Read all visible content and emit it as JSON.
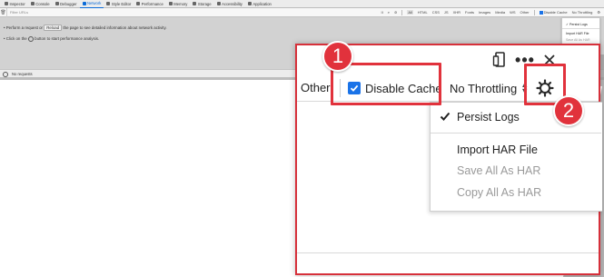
{
  "background": {
    "tabs": [
      {
        "label": "Inspector"
      },
      {
        "label": "Console"
      },
      {
        "label": "Debugger"
      },
      {
        "label": "Network",
        "active": true
      },
      {
        "label": "Style Editor"
      },
      {
        "label": "Performance"
      },
      {
        "label": "Memory"
      },
      {
        "label": "Storage"
      },
      {
        "label": "Accessibility"
      },
      {
        "label": "Application"
      }
    ],
    "filter_placeholder": "Filter URLs",
    "type_filters": [
      "All",
      "HTML",
      "CSS",
      "JS",
      "XHR",
      "Fonts",
      "Images",
      "Media",
      "WS",
      "Other"
    ],
    "disable_cache_label": "Disable Cache",
    "throttling_label": "No Throttling",
    "instruction_1_pre": "• Perform a request or",
    "instruction_1_button": "Reload",
    "instruction_1_post": "the page to see detailed information about network activity.",
    "instruction_2_pre": "• Click on the",
    "instruction_2_post": "button to start performance analysis.",
    "status": "No requests",
    "menu": {
      "persist": "Persist Logs",
      "import": "Import HAR File",
      "save": "Save All As HAR",
      "copy": "Copy All As HAR"
    }
  },
  "zoom": {
    "other_label": "Other",
    "disable_cache_label": "Disable Cache",
    "disable_cache_checked": true,
    "throttling_label": "No Throttling",
    "menu": {
      "persist_logs": "Persist Logs",
      "persist_logs_checked": true,
      "import_har": "Import HAR File",
      "save_all_har": "Save All As HAR",
      "copy_all_har": "Copy All As HAR"
    }
  },
  "annotations": {
    "badge_1": "1",
    "badge_2": "2"
  },
  "colors": {
    "accent_red": "#e1323c",
    "checkbox_blue": "#1a73e8",
    "active_tab_blue": "#0b6bd8"
  }
}
